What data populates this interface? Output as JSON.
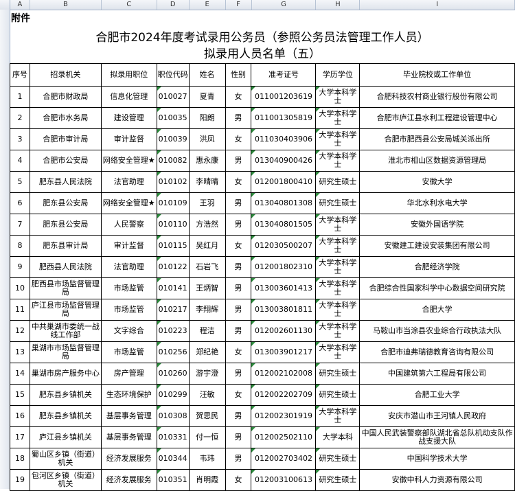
{
  "columns": [
    "A",
    "B",
    "C",
    "D",
    "E",
    "F",
    "G",
    "H",
    "I"
  ],
  "attachment_label": "附件",
  "title_line1": "合肥市2024年度考试录用公务员（参照公务员法管理工作人员）",
  "title_line2": "拟录用人员名单（五）",
  "headers": {
    "seq": "序号",
    "agency": "招录机关",
    "position": "拟录用职位",
    "code": "职位代码",
    "name": "姓名",
    "gender": "性别",
    "exam_no": "准考证号",
    "degree": "学历学位",
    "school": "毕业院校或工作单位"
  },
  "rows": [
    {
      "seq": "1",
      "agency": "合肥市财政局",
      "position": "信息化管理",
      "code": "010027",
      "name": "夏青",
      "gender": "女",
      "exam_no": "011001203619",
      "degree": "大学本科学士",
      "school": "合肥科技农村商业银行股份有限公司"
    },
    {
      "seq": "2",
      "agency": "合肥市水务局",
      "position": "建设管理",
      "code": "010035",
      "name": "阳朗",
      "gender": "男",
      "exam_no": "011001305819",
      "degree": "大学本科学士",
      "school": "合肥市庐江县水利工程建设管理中心"
    },
    {
      "seq": "3",
      "agency": "合肥市审计局",
      "position": "审计监督",
      "code": "010039",
      "name": "洪凤",
      "gender": "女",
      "exam_no": "011030403906",
      "degree": "大学本科学士",
      "school": "合肥市肥西县公安局城关派出所"
    },
    {
      "seq": "4",
      "agency": "合肥市公安局",
      "position": "网络安全管理★",
      "code": "010082",
      "name": "惠永康",
      "gender": "男",
      "exam_no": "013040900426",
      "degree": "大学本科学士",
      "school": "淮北市相山区数据资源管理局"
    },
    {
      "seq": "5",
      "agency": "肥东县人民法院",
      "position": "法官助理",
      "code": "010102",
      "name": "李晴晴",
      "gender": "女",
      "exam_no": "012001800410",
      "degree": "研究生硕士",
      "school": "安徽大学"
    },
    {
      "seq": "6",
      "agency": "肥东县公安局",
      "position": "网络安全管理★",
      "code": "010109",
      "name": "王羽",
      "gender": "男",
      "exam_no": "013040801308",
      "degree": "研究生硕士",
      "school": "华北水利水电大学"
    },
    {
      "seq": "7",
      "agency": "肥东县公安局",
      "position": "人民警察",
      "code": "010110",
      "name": "方浩然",
      "gender": "男",
      "exam_no": "013040801505",
      "degree": "大学本科学士",
      "school": "安徽外国语学院"
    },
    {
      "seq": "8",
      "agency": "肥东县审计局",
      "position": "审计监督",
      "code": "010115",
      "name": "吴红月",
      "gender": "女",
      "exam_no": "012030500207",
      "degree": "大学本科学士",
      "school": "安徽建工建设安装集团有限公司"
    },
    {
      "seq": "9",
      "agency": "肥西县人民法院",
      "position": "法官助理",
      "code": "010122",
      "name": "石岩飞",
      "gender": "男",
      "exam_no": "012001802310",
      "degree": "大学本科学士",
      "school": "合肥经济学院"
    },
    {
      "seq": "10",
      "agency": "肥西县市场监督管理局",
      "position": "市场监管",
      "code": "010141",
      "name": "王炳智",
      "gender": "男",
      "exam_no": "013003601413",
      "degree": "大学本科学士",
      "school": "合肥综合性国家科学中心数据空间研究院"
    },
    {
      "seq": "11",
      "agency": "庐江县市场监督管理局",
      "position": "市场监管",
      "code": "010217",
      "name": "李翔辉",
      "gender": "男",
      "exam_no": "013003801811",
      "degree": "大学本科学士",
      "school": "合肥大学"
    },
    {
      "seq": "12",
      "agency": "中共巢湖市委统一战线工作部",
      "position": "文字综合",
      "code": "010223",
      "name": "程洁",
      "gender": "男",
      "exam_no": "012002601130",
      "degree": "大学本科学士",
      "school": "马鞍山市当涂县农业综合行政执法大队"
    },
    {
      "seq": "13",
      "agency": "巢湖市市场监督管理局",
      "position": "市场监管",
      "code": "010256",
      "name": "郑纪艳",
      "gender": "女",
      "exam_no": "013003901217",
      "degree": "大学本科学士",
      "school": "合肥市迪弗瑞德教育咨询有限公司"
    },
    {
      "seq": "14",
      "agency": "巢湖市房产服务中心",
      "position": "房产管理",
      "code": "010260",
      "name": "游宇澄",
      "gender": "男",
      "exam_no": "012002102008",
      "degree": "研究生硕士",
      "school": "中国建筑第六工程局有限公司"
    },
    {
      "seq": "15",
      "agency": "肥东县乡镇机关",
      "position": "生态环境保护",
      "code": "010299",
      "name": "汪敏",
      "gender": "女",
      "exam_no": "012002202709",
      "degree": "研究生硕士",
      "school": "合肥工业大学"
    },
    {
      "seq": "16",
      "agency": "肥东县乡镇机关",
      "position": "基层事务管理",
      "code": "010308",
      "name": "贺思民",
      "gender": "男",
      "exam_no": "012002301919",
      "degree": "大学本科学士",
      "school": "安庆市潜山市王河镇人民政府"
    },
    {
      "seq": "17",
      "agency": "庐江县乡镇机关",
      "position": "基层事务管理",
      "code": "010331",
      "name": "付一恒",
      "gender": "男",
      "exam_no": "012002502110",
      "degree": "大学本科",
      "school": "中国人民武装警察部队湖北省总队机动支队作战支援大队"
    },
    {
      "seq": "18",
      "agency": "蜀山区乡镇（街道）机关",
      "position": "经济发展服务",
      "code": "010344",
      "name": "韦玮",
      "gender": "男",
      "exam_no": "012002703402",
      "degree": "研究生硕士",
      "school": "中国科学技术大学"
    },
    {
      "seq": "19",
      "agency": "包河区乡镇（街道）机关",
      "position": "经济发展服务",
      "code": "010351",
      "name": "肖明霞",
      "gender": "女",
      "exam_no": "012003100613",
      "degree": "研究生硕士",
      "school": "安徽中科人力资源有限公司"
    }
  ],
  "colors": {
    "header_bg": "#e1e6ee",
    "code_marker": "#2e8b3e"
  }
}
